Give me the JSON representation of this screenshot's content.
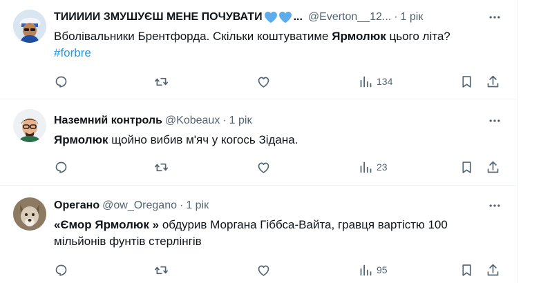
{
  "tweets": [
    {
      "author_name": "ТИИИИИ ЗМУШУЄШ МЕНЕ ПОЧУВАТИ",
      "name_suffix": "...",
      "handle": "@Everton__12...",
      "separator": "·",
      "time": "1 рік",
      "text_1": "Вболівальники Брентфорда. Скільки коштуватиме ",
      "text_bold": "Ярмолюк",
      "text_2": " цього літа?",
      "hashtag": "#forbre",
      "views": "134",
      "icons": [
        "more-icon",
        "reply-icon",
        "retweet-icon",
        "like-icon",
        "views-icon",
        "bookmark-icon",
        "share-icon"
      ],
      "emoji": [
        "blue-heart",
        "blue-heart"
      ]
    },
    {
      "author_name": "Наземний контроль",
      "handle": "@Kobeaux",
      "separator": "·",
      "time": "1 рік",
      "text_bold": "Ярмолюк",
      "text_2": " щойно вибив м'яч у когось Зідана.",
      "views": "23"
    },
    {
      "author_name": "Орегано",
      "handle": "@ow_Oregano",
      "separator": "·",
      "time": "1 рік",
      "text_bold": "«Ємор Ярмолюк »",
      "text_2": " обдурив Моргана Гіббса-Вайта, гравця вартістю 100 мільйонів фунтів стерлінгів",
      "views": "95"
    }
  ],
  "colors": {
    "text": "#0f1419",
    "secondary": "#536471",
    "accent": "#1d9bf0",
    "divider": "#eff3f4"
  }
}
